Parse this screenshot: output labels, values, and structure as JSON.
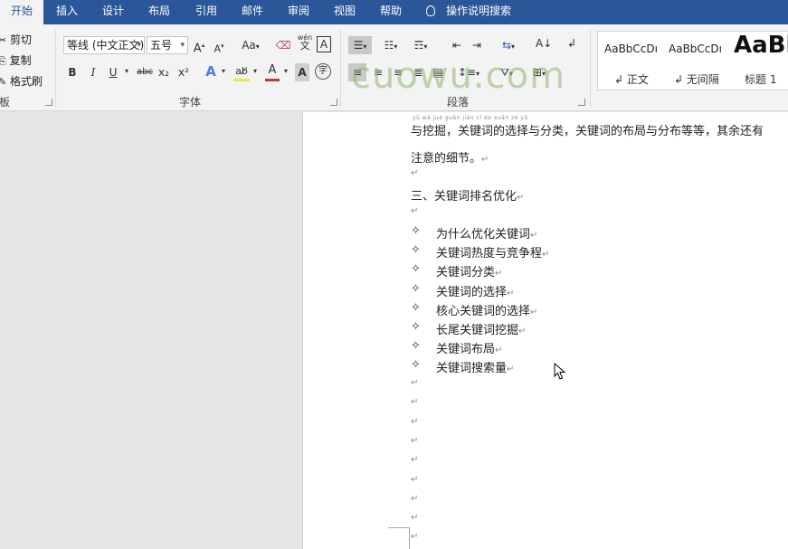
{
  "tabs": [
    {
      "label": "开始",
      "active": true
    },
    {
      "label": "插入"
    },
    {
      "label": "设计"
    },
    {
      "label": "布局"
    },
    {
      "label": "引用"
    },
    {
      "label": "邮件"
    },
    {
      "label": "审阅"
    },
    {
      "label": "视图"
    },
    {
      "label": "帮助"
    }
  ],
  "tell_me": "操作说明搜索",
  "clipboard": {
    "cut": "剪切",
    "copy": "复制",
    "format_painter": "格式刷",
    "label": "板"
  },
  "font": {
    "family": "等线 (中文正文)",
    "size": "五号",
    "label": "字体",
    "bold": "B",
    "italic": "I",
    "underline": "U",
    "strike": "abc",
    "subscript": "x₂",
    "superscript": "x²",
    "grow": "A",
    "shrink": "A",
    "case": "Aa",
    "phonetic": "wén",
    "phonetic_char": "文",
    "enclose": "字",
    "highlight_color": "#f5e33b",
    "font_color": "#c0392b"
  },
  "paragraph": {
    "label": "段落"
  },
  "styles": {
    "items": [
      {
        "sample": "AaBbCcDı",
        "name": "↲ 正文"
      },
      {
        "sample": "AaBbCcDı",
        "name": "↲ 无间隔"
      },
      {
        "sample": "AaBl",
        "name": "标题 1"
      }
    ]
  },
  "watermark": "cuowu.com",
  "document": {
    "ruby_text": "yǔ wā jué    guān jiàn cí de xuǎn zé yǔ",
    "line1": "与挖掘，关键词的选择与分类，关键词的布局与分布等等，其余还有",
    "line2": "注意的细节。",
    "heading": "三、关键词排名优化",
    "bullet_symbol": "✧",
    "para_mark": "↵",
    "bullets": [
      "为什么优化关键词",
      "关键词热度与竞争程",
      "关键词分类",
      "关键词的选择",
      "核心关键词的选择",
      "长尾关键词挖掘",
      "关键词布局",
      "关键词搜索量"
    ]
  }
}
